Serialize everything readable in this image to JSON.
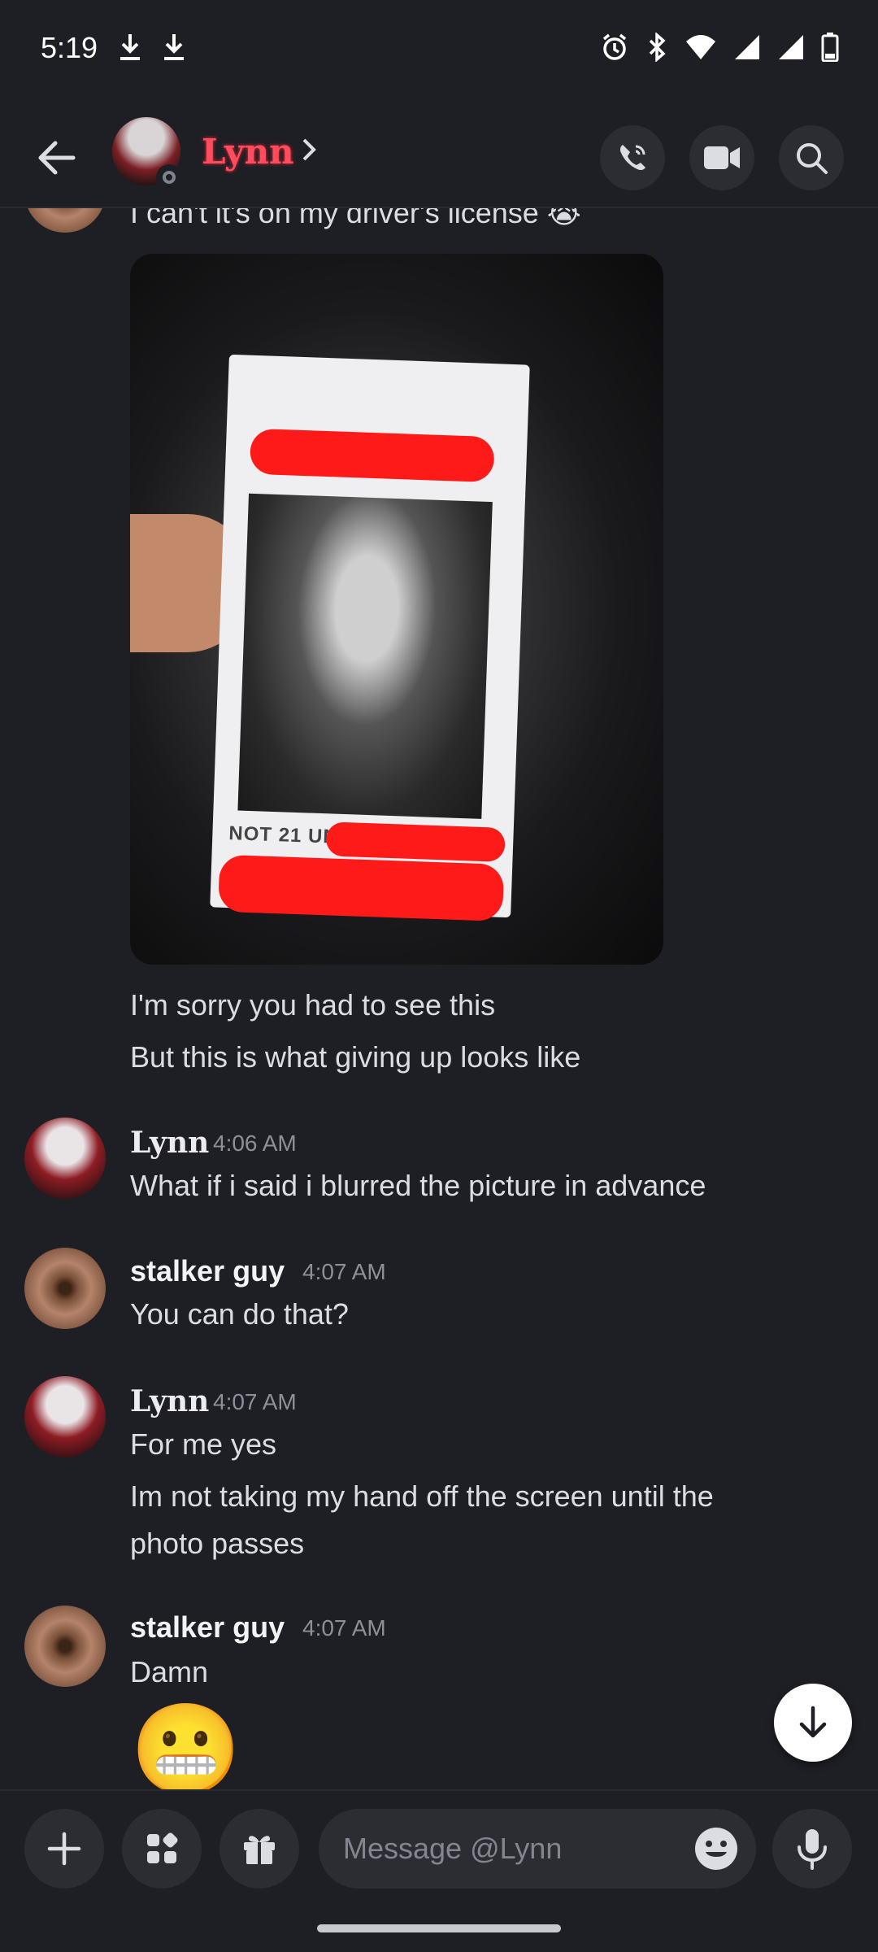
{
  "status_bar": {
    "time": "5:19"
  },
  "header": {
    "contact_name": "Lynn"
  },
  "messages": {
    "top_text": "I can't it's on my driver's license 😭",
    "photo_caption": "NOT 21 UNTIL",
    "line_sorry": "I'm sorry you had to see this",
    "line_giving_up": "But this is what giving up looks like",
    "group1": {
      "author": "Lynn",
      "time": "4:06 AM",
      "text": "What if i said i blurred the picture in advance"
    },
    "group2": {
      "author": "stalker guy",
      "time": "4:07 AM",
      "text": "You can do that?"
    },
    "group3": {
      "author": "Lynn",
      "time": "4:07 AM",
      "text1": "For me yes",
      "text2a": "Im not taking my hand off the screen until the",
      "text2b": "photo passes"
    },
    "group4": {
      "author": "stalker guy",
      "time": "4:07 AM",
      "text": "Damn",
      "emoji": "😬"
    }
  },
  "composer": {
    "placeholder": "Message @Lynn"
  },
  "colors": {
    "background": "#1e1f24",
    "button_bg": "#2b2d33",
    "name_accent": "#ff4d5e"
  },
  "icons": [
    "download-icon",
    "alarm-icon",
    "bluetooth-icon",
    "wifi-icon",
    "signal-icon",
    "battery-icon",
    "back-arrow-icon",
    "phone-icon",
    "video-icon",
    "search-icon",
    "arrow-down-icon",
    "plus-icon",
    "apps-icon",
    "gift-icon",
    "emoji-icon",
    "microphone-icon"
  ]
}
